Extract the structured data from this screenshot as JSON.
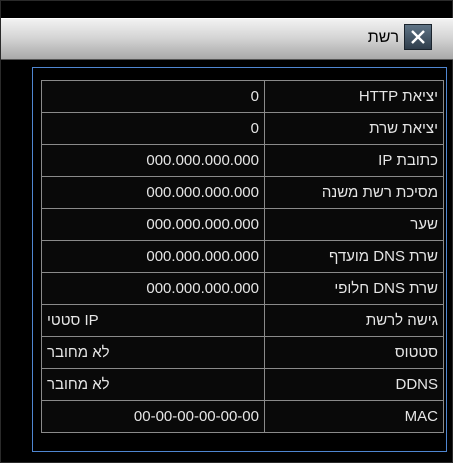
{
  "window": {
    "title": "רשת",
    "close_icon": "close-icon"
  },
  "settings": [
    {
      "label": "יציאת HTTP",
      "value": "0"
    },
    {
      "label": "יציאת שרת",
      "value": "0"
    },
    {
      "label": "כתובת IP",
      "value": "000.000.000.000"
    },
    {
      "label": "מסיכת רשת משנה",
      "value": "000.000.000.000"
    },
    {
      "label": "שער",
      "value": "000.000.000.000"
    },
    {
      "label": "שרת DNS מועדף",
      "value": "000.000.000.000"
    },
    {
      "label": "שרת DNS חלופי",
      "value": "000.000.000.000"
    },
    {
      "label": "גישה לרשת",
      "value": "IP סטטי"
    },
    {
      "label": "סטטוס",
      "value": "לא מחובר"
    },
    {
      "label": "DDNS",
      "value": "לא מחובר"
    },
    {
      "label": "MAC",
      "value": "00-00-00-00-00-00"
    }
  ]
}
